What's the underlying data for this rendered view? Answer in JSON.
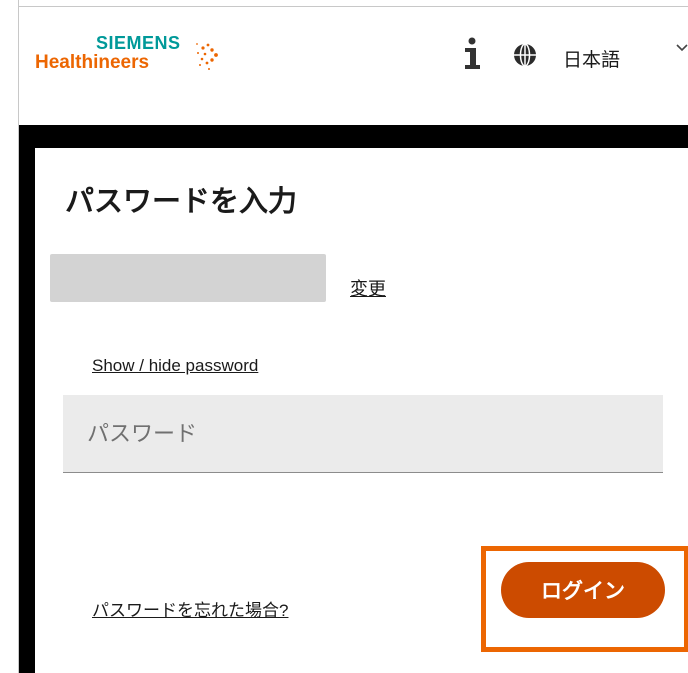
{
  "header": {
    "logo": {
      "line1": "SIEMENS",
      "line2": "Healthineers"
    },
    "info_icon": "info-icon",
    "globe_icon": "globe-icon",
    "language": "日本語",
    "language_dropdown_icon": "chevron-down-icon"
  },
  "card": {
    "title": "パスワードを入力",
    "username_value": "",
    "change_link": "変更",
    "toggle_password_link": "Show / hide password",
    "password_placeholder": "パスワード",
    "password_value": "",
    "forgot_link": "パスワードを忘れた場合?",
    "login_button": "ログイン"
  },
  "colors": {
    "brand_teal": "#009999",
    "brand_orange": "#ec6602",
    "button_bg": "#cc4b00",
    "highlight_border": "#ec6602",
    "backdrop": "#000000"
  }
}
